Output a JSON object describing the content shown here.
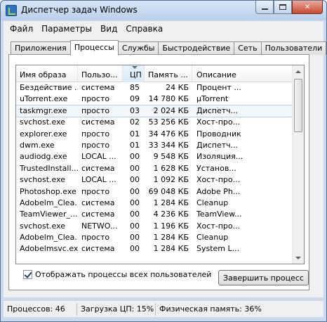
{
  "window": {
    "title": "Диспетчер задач Windows"
  },
  "menu": [
    "Файл",
    "Параметры",
    "Вид",
    "Справка"
  ],
  "tabs": [
    {
      "label": "Приложения",
      "w": 76
    },
    {
      "label": "Процессы",
      "w": 62
    },
    {
      "label": "Службы",
      "w": 56
    },
    {
      "label": "Быстродействие",
      "w": 98
    },
    {
      "label": "Сеть",
      "w": 42
    },
    {
      "label": "Пользователи",
      "w": 82
    }
  ],
  "table": {
    "columns": [
      "Имя образа",
      "Пользо...",
      "ЦП",
      "Память ...",
      "Описание"
    ],
    "rows": [
      [
        "Бездействие ...",
        "система",
        "85",
        "24 КБ",
        "Процент ..."
      ],
      [
        "uTorrent.exe",
        "просто",
        "09",
        "14 780 КБ",
        "µTorrent"
      ],
      [
        "taskmgr.exe",
        "просто",
        "03",
        "2 024 КБ",
        "Диспетч..."
      ],
      [
        "svchost.exe",
        "система",
        "02",
        "53 256 КБ",
        "Хост-про..."
      ],
      [
        "explorer.exe",
        "просто",
        "01",
        "34 476 КБ",
        "Проводник"
      ],
      [
        "dwm.exe",
        "просто",
        "01",
        "33 344 КБ",
        "Диспетч..."
      ],
      [
        "audiodg.exe",
        "LOCAL ...",
        "00",
        "9 548 КБ",
        "Изоляция..."
      ],
      [
        "TrustedInstall...",
        "система",
        "00",
        "1 628 КБ",
        "Установ..."
      ],
      [
        "svchost.exe",
        "LOCAL ...",
        "00",
        "1 092 КБ",
        "Хост-про..."
      ],
      [
        "Photoshop.exe",
        "просто",
        "00",
        "69 048 КБ",
        "Adobe Ph..."
      ],
      [
        "Adobelm_Clea...",
        "система",
        "00",
        "1 284 КБ",
        "Cleanup"
      ],
      [
        "TeamViewer_...",
        "система",
        "00",
        "4 236 КБ",
        "TeamView..."
      ],
      [
        "svchost.exe",
        "NETWO...",
        "00",
        "1 196 КБ",
        "Хост-про..."
      ],
      [
        "Adobelm_Clea...",
        "просто",
        "00",
        "1 284 КБ",
        "Cleanup"
      ],
      [
        "Adobelmsvc.exe",
        "система",
        "00",
        "1 284 КБ",
        "System L..."
      ]
    ],
    "selected_row": 2
  },
  "show_all_label": "Отображать процессы всех пользователей",
  "end_process_label": "Завершить процесс",
  "status": {
    "processes": "Процессов: 46",
    "cpu": "Загрузка ЦП: 15%",
    "memory": "Физическая память: 36%"
  }
}
